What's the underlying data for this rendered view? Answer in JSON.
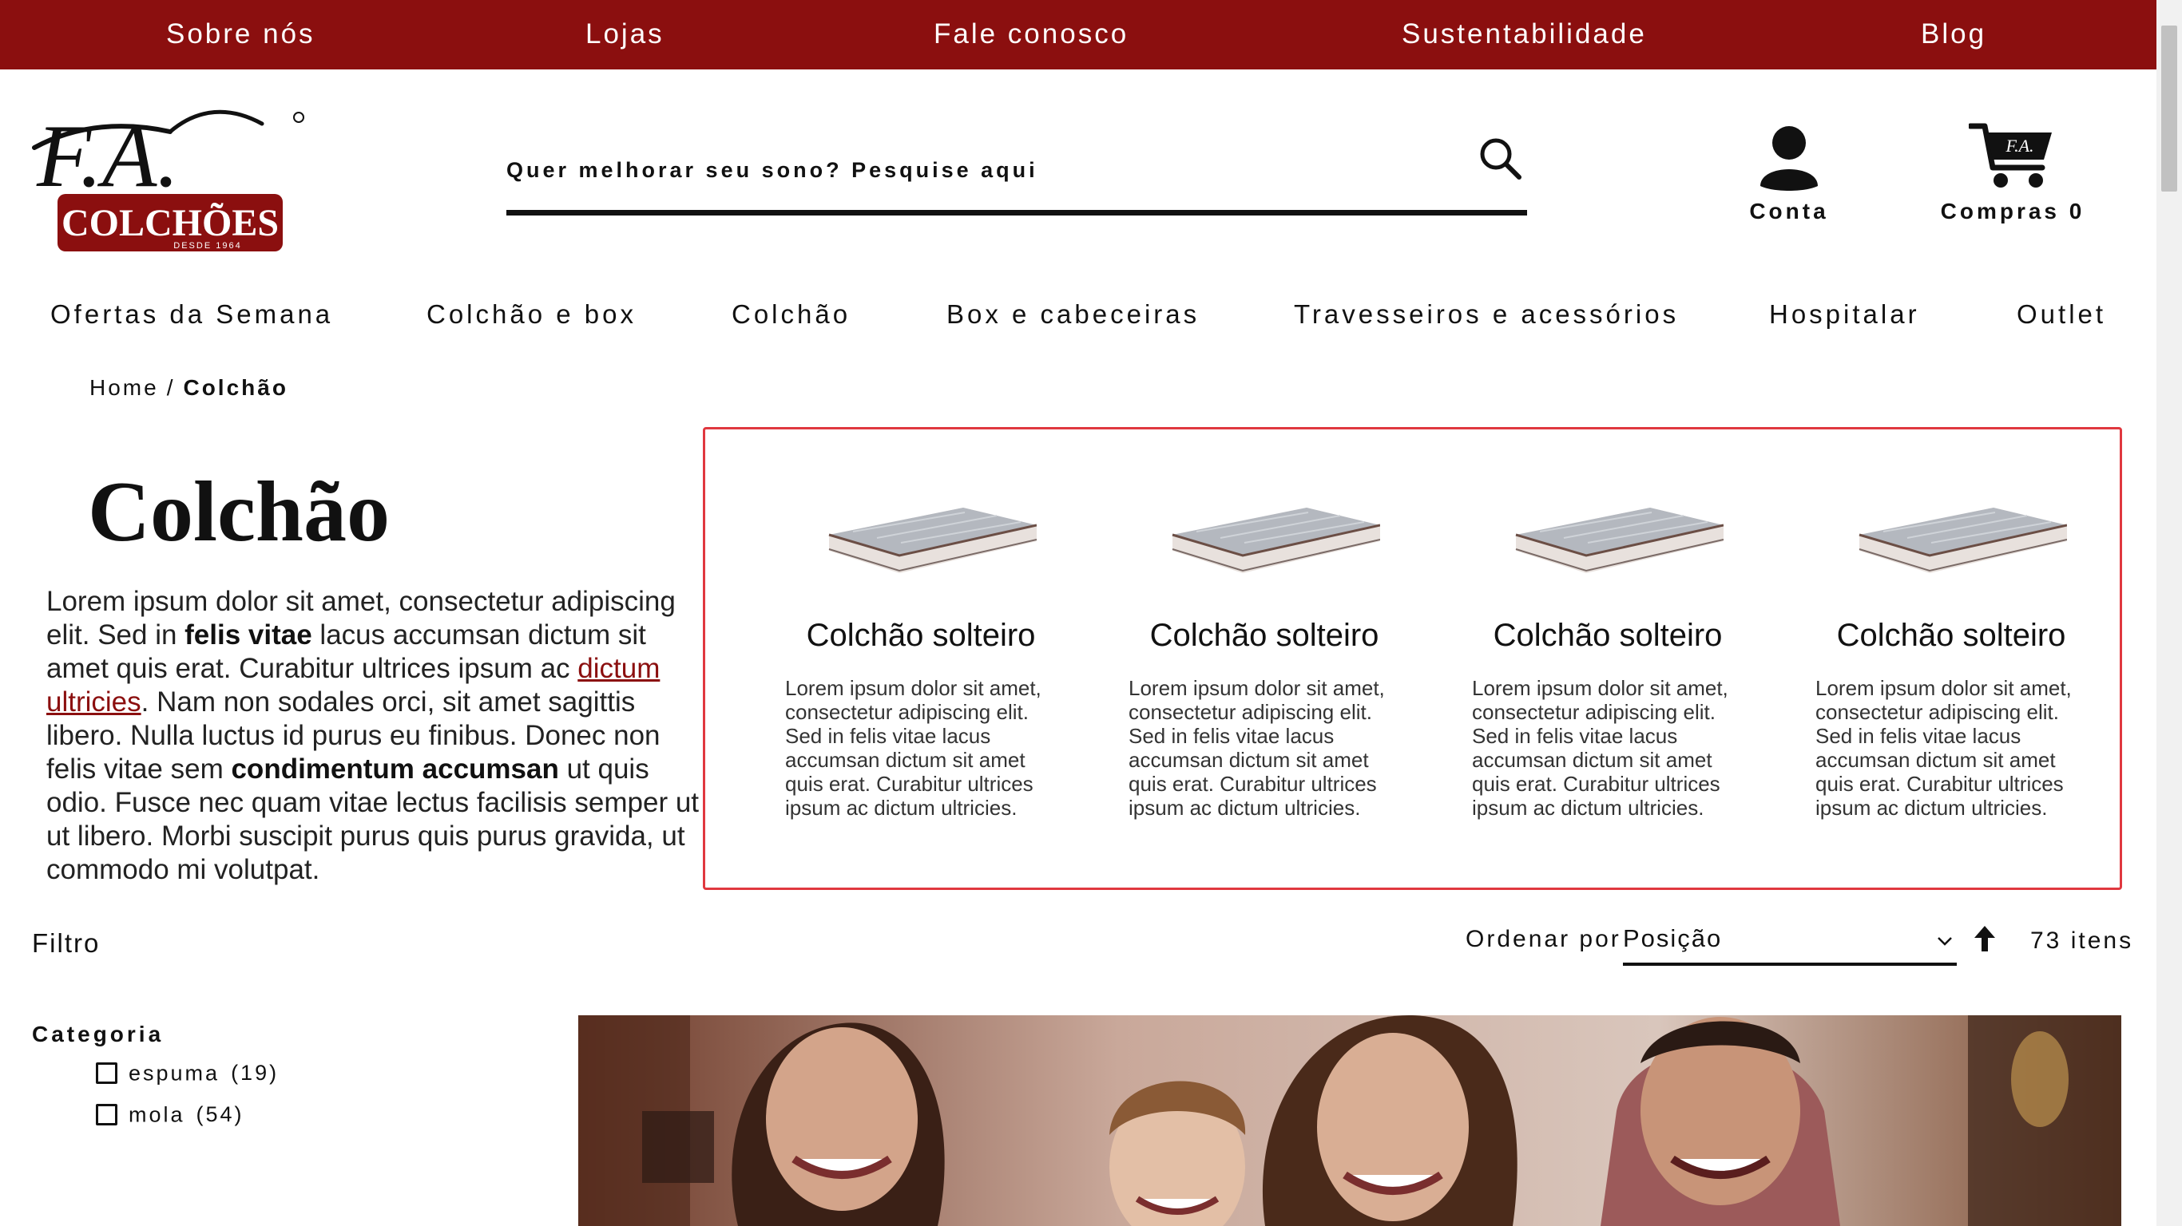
{
  "colors": {
    "brand": "#8b0f0f",
    "highlight_border": "#e0383f",
    "text": "#111111"
  },
  "topbar": {
    "links": [
      {
        "label": "Sobre nós"
      },
      {
        "label": "Lojas"
      },
      {
        "label": "Fale conosco"
      },
      {
        "label": "Sustentabilidade"
      },
      {
        "label": "Blog"
      }
    ]
  },
  "header": {
    "logo": {
      "brand_initials": "F.A.",
      "brand_name": "COLCHÕES",
      "since": "DESDE 1964",
      "icon": "fa-colchoes-logo"
    },
    "search": {
      "placeholder": "Quer melhorar seu sono? Pesquise aqui",
      "icon": "search-icon"
    },
    "account": {
      "label": "Conta",
      "icon": "user-icon"
    },
    "cart": {
      "label": "Compras 0",
      "icon": "cart-icon"
    }
  },
  "nav": {
    "items": [
      {
        "label": "Ofertas da Semana"
      },
      {
        "label": "Colchão e box"
      },
      {
        "label": "Colchão"
      },
      {
        "label": "Box e cabeceiras"
      },
      {
        "label": "Travesseiros e acessórios"
      },
      {
        "label": "Hospitalar"
      },
      {
        "label": "Outlet"
      }
    ]
  },
  "breadcrumb": {
    "home": "Home",
    "separator": "/",
    "current": "Colchão"
  },
  "category": {
    "title": "Colchão",
    "intro": {
      "t1": "Lorem ipsum dolor sit amet, consectetur adipiscing elit. Sed in ",
      "b1": "felis vitae",
      "t2": " lacus accumsan dictum sit amet quis erat. Curabitur ultrices ipsum ac ",
      "link": "dictum ultricies",
      "t3": ". Nam non sodales orci, sit amet sagittis libero. Nulla luctus id purus eu finibus. Donec non felis vitae sem ",
      "b2": "condimentum accumsan",
      "t4": " ut quis odio. Fusce nec quam vitae lectus facilisis semper ut ut libero. Morbi suscipit purus quis purus gravida, ut commodo mi volutpat."
    }
  },
  "featured": {
    "cards": [
      {
        "title": "Colchão solteiro",
        "text": "Lorem ipsum dolor sit amet, consectetur adipiscing elit. Sed in felis vitae lacus accumsan dictum sit amet quis erat. Curabitur ultrices ipsum ac dictum ultricies."
      },
      {
        "title": "Colchão solteiro",
        "text": "Lorem ipsum dolor sit amet, consectetur adipiscing elit. Sed in felis vitae lacus accumsan dictum sit amet quis erat. Curabitur ultrices ipsum ac dictum ultricies."
      },
      {
        "title": "Colchão solteiro",
        "text": "Lorem ipsum dolor sit amet, consectetur adipiscing elit. Sed in felis vitae lacus accumsan dictum sit amet quis erat. Curabitur ultrices ipsum ac dictum ultricies."
      },
      {
        "title": "Colchão solteiro",
        "text": "Lorem ipsum dolor sit amet, consectetur adipiscing elit. Sed in felis vitae lacus accumsan dictum sit amet quis erat. Curabitur ultrices ipsum ac dictum ultricies."
      }
    ]
  },
  "toolbar": {
    "filter_label": "Filtro",
    "sort_label": "Ordenar por",
    "sort_value": "Posição",
    "sort_direction_icon": "arrow-up-icon",
    "item_count": "73 itens"
  },
  "filters": {
    "category_title": "Categoria",
    "options": [
      {
        "label": "espuma",
        "count": "(19)",
        "checked": false
      },
      {
        "label": "mola",
        "count": "(54)",
        "checked": false
      }
    ]
  }
}
